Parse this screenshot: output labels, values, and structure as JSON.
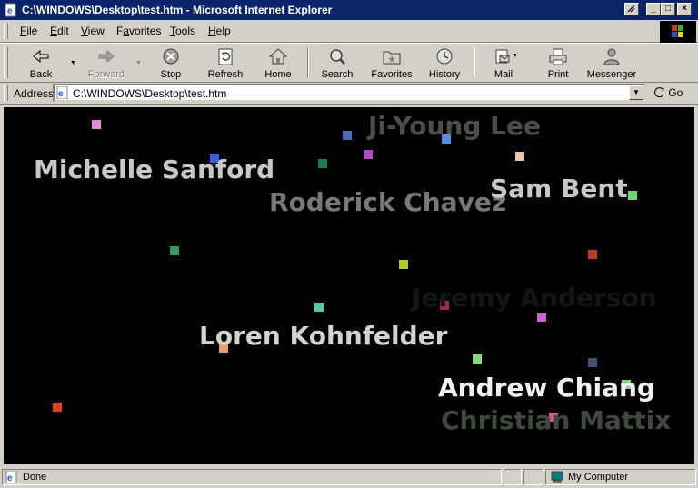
{
  "window": {
    "title": "C:\\WINDOWS\\Desktop\\test.htm - Microsoft Internet Explorer",
    "minimize": "_",
    "maximize": "□",
    "close": "×"
  },
  "menubar": {
    "items": [
      {
        "label": "File",
        "accel": "F",
        "rest": "ile"
      },
      {
        "label": "Edit",
        "accel": "E",
        "rest": "dit"
      },
      {
        "label": "View",
        "accel": "V",
        "rest": "iew"
      },
      {
        "label": "Favorites",
        "accel": "a",
        "pre": "F",
        "rest": "vorites"
      },
      {
        "label": "Tools",
        "accel": "T",
        "rest": "ools"
      },
      {
        "label": "Help",
        "accel": "H",
        "rest": "elp"
      }
    ]
  },
  "toolbar": {
    "back": "Back",
    "forward": "Forward",
    "stop": "Stop",
    "refresh": "Refresh",
    "home": "Home",
    "search": "Search",
    "favorites": "Favorites",
    "history": "History",
    "mail": "Mail",
    "print": "Print",
    "messenger": "Messenger"
  },
  "address": {
    "label": "Address",
    "value": "C:\\WINDOWS\\Desktop\\test.htm",
    "go": "Go"
  },
  "page": {
    "background": "#000000",
    "names": [
      {
        "text": "Ji-Young Lee",
        "color": "#4a5048"
      },
      {
        "text": "Michelle Sanford",
        "color": "#c8c8c8"
      },
      {
        "text": "Roderick Chavez",
        "color": "#787878"
      },
      {
        "text": "Sam Bent",
        "color": "#c8c8c8"
      },
      {
        "text": "Jeremy Anderson",
        "color": "#0e1a10"
      },
      {
        "text": "Loren Kohnfelder",
        "color": "#d2d4cc"
      },
      {
        "text": "Andrew Chiang",
        "color": "#f0f0f0"
      },
      {
        "text": "Christian Mattix",
        "color": "#3c4a3c"
      }
    ],
    "dot_colors": [
      "#e48ad8",
      "#3a5ee0",
      "#4a6cb4",
      "#1e7a4c",
      "#b04ac8",
      "#5a8ee0",
      "#e8c8a8",
      "#6adc6a",
      "#2aa060",
      "#b0cc20",
      "#c83820",
      "#5ac8a8",
      "#a02850",
      "#d060d0",
      "#e4a070",
      "#8ad87a",
      "#405078",
      "#7ad87a",
      "#d85098",
      "#d84028"
    ]
  },
  "status": {
    "text": "Done",
    "zone": "My Computer"
  }
}
